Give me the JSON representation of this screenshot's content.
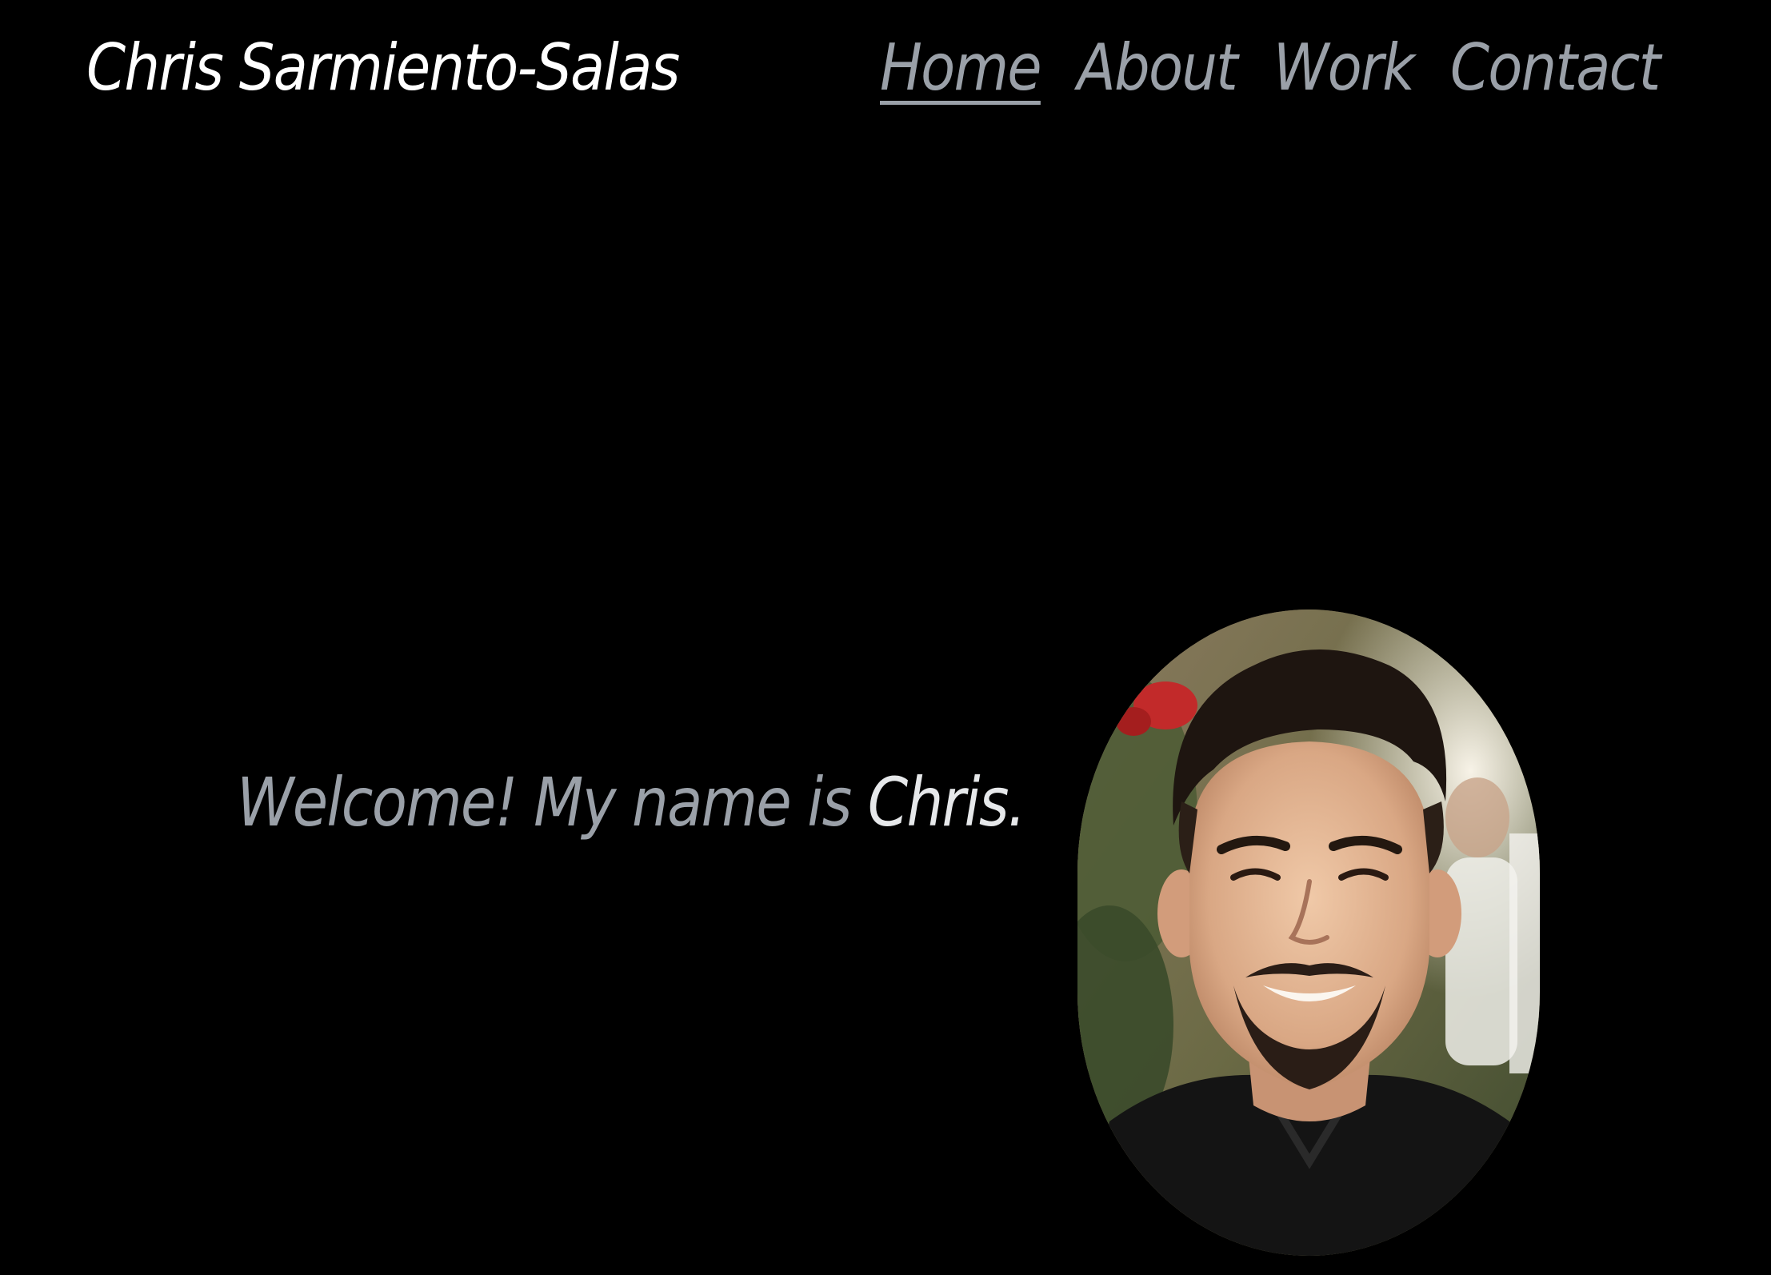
{
  "site": {
    "title": "Chris Sarmiento-Salas"
  },
  "nav": {
    "items": [
      {
        "label": "Home",
        "active": true
      },
      {
        "label": "About",
        "active": false
      },
      {
        "label": "Work",
        "active": false
      },
      {
        "label": "Contact",
        "active": false
      }
    ]
  },
  "hero": {
    "greeting": "Welcome! My name is ",
    "name": "Chris."
  },
  "colors": {
    "background": "#000000",
    "title": "#ffffff",
    "nav_text": "#9aa0a8",
    "greeting_text": "#9aa0a8",
    "name_text": "#e6e8ea"
  }
}
